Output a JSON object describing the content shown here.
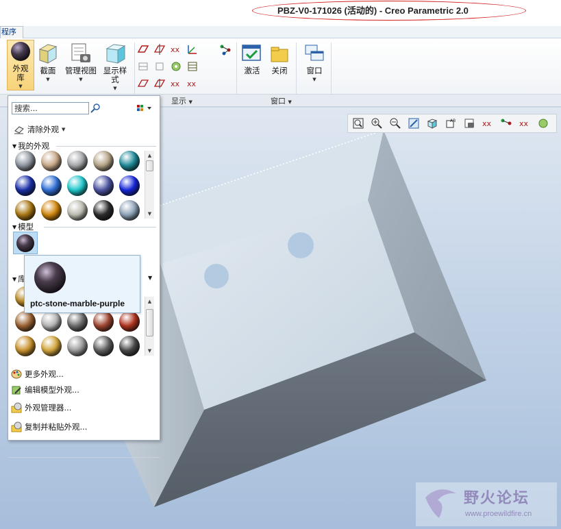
{
  "window": {
    "title": "PBZ-V0-171026 (活动的) - Creo Parametric 2.0"
  },
  "tabs": {
    "current": "程序"
  },
  "ribbon": {
    "appearance_gallery": {
      "label_line1": "外观",
      "label_line2": "库"
    },
    "section": {
      "label": "截面"
    },
    "manage_views": {
      "label": "管理视图"
    },
    "display_style": {
      "label_line1": "显示样",
      "label_line2": "式"
    },
    "activate": {
      "label": "激活"
    },
    "close": {
      "label": "关闭"
    },
    "window_btn": {
      "label": "窗口"
    },
    "groups": {
      "display": "显示",
      "window": "窗口"
    }
  },
  "appearance_panel": {
    "search_placeholder": "搜索...",
    "clear_appearance": "清除外观",
    "my_appearances": "我的外观",
    "model": "模型",
    "library": "库",
    "my_swatches": [
      "#8f96a0",
      "#c9a98a",
      "#a7a9ab",
      "#b6a488",
      "#1f8a99",
      "#1a2fa8",
      "#2f6fd6",
      "#20c7cc",
      "#4d55a3",
      "#1426d9",
      "#a97712",
      "#d0860c",
      "#bcbcb0",
      "#2c2c2c",
      "#8da3b8"
    ],
    "library_swatches": [
      "#b98a2a",
      "#b0b0b0",
      "#8e8e8e",
      "#4e4e4e",
      "#3c3a34",
      "#9c6332",
      "#b5b5b5",
      "#6c6c6c",
      "#a04632",
      "#b0341e",
      "#c8922e",
      "#d2a53c",
      "#9a9a9a",
      "#606060",
      "#494949"
    ],
    "model_swatch": "#4a3d4c",
    "tooltip_name": "ptc-stone-marble-purple",
    "menu": {
      "more": "更多外观...",
      "edit_model": "编辑模型外观...",
      "manager": "外观管理器...",
      "copy_paste": "复制并粘贴外观..."
    }
  },
  "watermark": {
    "name": "野火论坛",
    "url": "www.proewildfire.cn"
  },
  "colors": {
    "accent_red": "#d21d1d",
    "viewport_top": "#dfe7f1",
    "viewport_bottom": "#a6bedb"
  }
}
